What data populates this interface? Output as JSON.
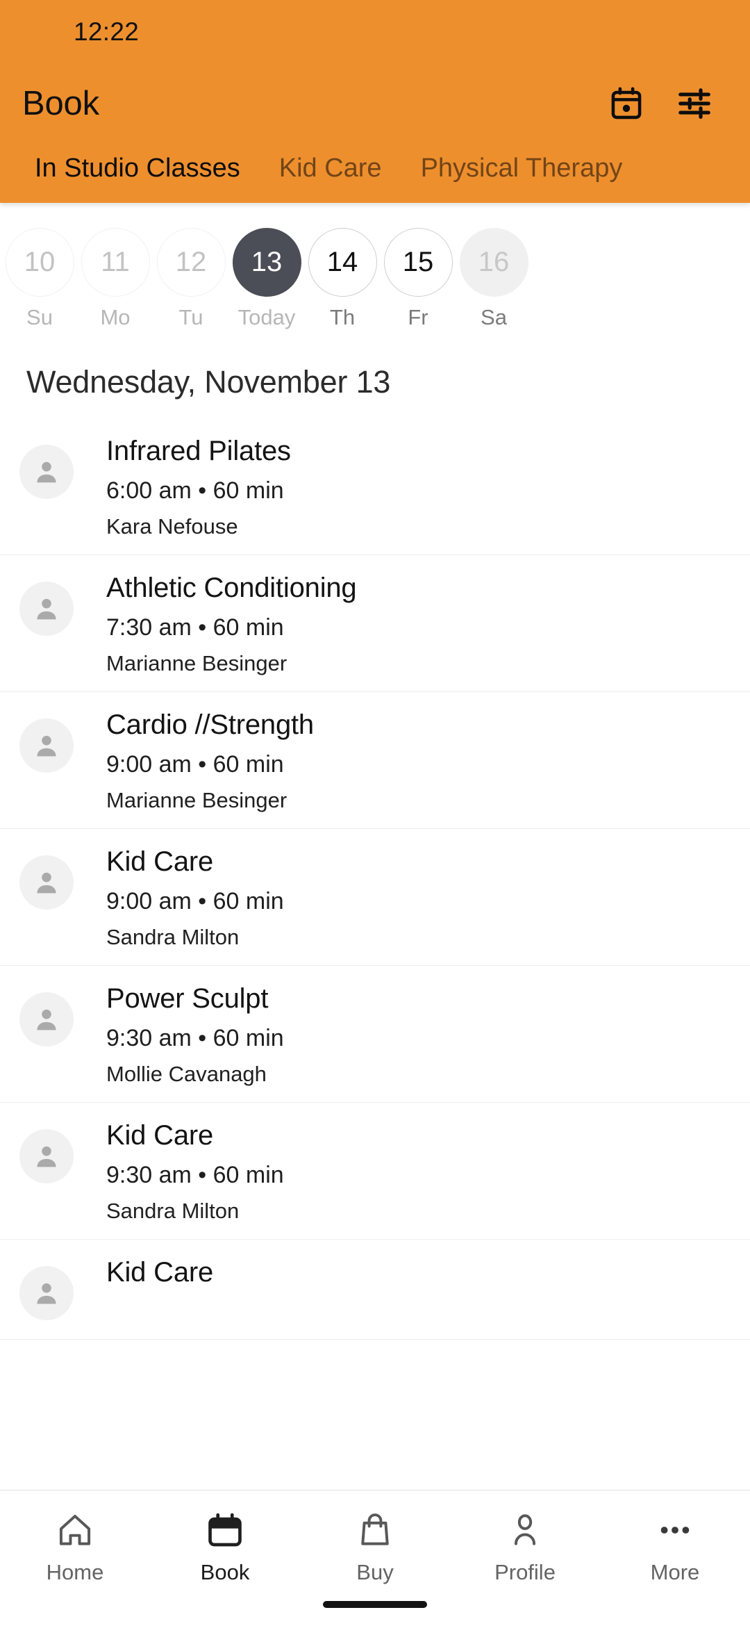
{
  "status_bar": {
    "time": "12:22"
  },
  "app_bar": {
    "title": "Book",
    "actions": [
      {
        "name": "calendar-icon",
        "label": "Calendar"
      },
      {
        "name": "filter-icon",
        "label": "Filters"
      }
    ]
  },
  "tabs": [
    {
      "label": "In Studio Classes",
      "active": true
    },
    {
      "label": "Kid Care",
      "active": false
    },
    {
      "label": "Physical Therapy",
      "active": false
    }
  ],
  "date_strip": {
    "days": [
      {
        "num": "10",
        "label": "Su",
        "state": "past"
      },
      {
        "num": "11",
        "label": "Mo",
        "state": "past"
      },
      {
        "num": "12",
        "label": "Tu",
        "state": "past"
      },
      {
        "num": "13",
        "label": "Today",
        "state": "selected"
      },
      {
        "num": "14",
        "label": "Th",
        "state": "future"
      },
      {
        "num": "15",
        "label": "Fr",
        "state": "future"
      },
      {
        "num": "16",
        "label": "Sa",
        "state": "muted"
      }
    ]
  },
  "day_heading": "Wednesday, November 13",
  "classes": [
    {
      "name": "Infrared Pilates",
      "meta": "6:00 am • 60 min",
      "teacher": "Kara Nefouse"
    },
    {
      "name": "Athletic Conditioning",
      "meta": "7:30 am • 60 min",
      "teacher": "Marianne Besinger"
    },
    {
      "name": "Cardio //Strength",
      "meta": "9:00 am • 60 min",
      "teacher": "Marianne Besinger"
    },
    {
      "name": "Kid Care",
      "meta": "9:00 am • 60 min",
      "teacher": "Sandra Milton"
    },
    {
      "name": "Power Sculpt",
      "meta": "9:30 am • 60 min",
      "teacher": "Mollie Cavanagh"
    },
    {
      "name": "Kid Care",
      "meta": "9:30 am • 60 min",
      "teacher": "Sandra Milton"
    },
    {
      "name": "Kid Care",
      "meta": "",
      "teacher": ""
    }
  ],
  "bottom_nav": [
    {
      "label": "Home",
      "icon": "home-icon",
      "active": false
    },
    {
      "label": "Book",
      "icon": "calendar-icon",
      "active": true
    },
    {
      "label": "Buy",
      "icon": "bag-icon",
      "active": false
    },
    {
      "label": "Profile",
      "icon": "person-icon",
      "active": false
    },
    {
      "label": "More",
      "icon": "more-icon",
      "active": false
    }
  ],
  "colors": {
    "brand_orange": "#ee8f2e",
    "selected_day": "#4b4e56",
    "divider": "#ededed"
  }
}
